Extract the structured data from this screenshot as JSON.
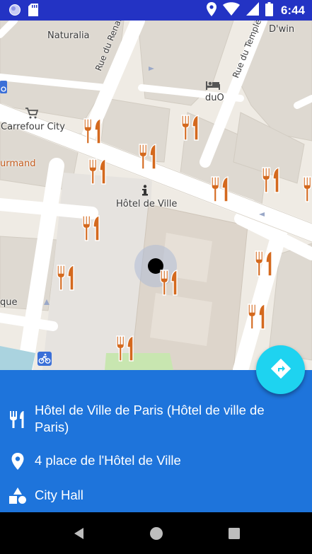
{
  "status_bar": {
    "time": "6:44",
    "left_icons": [
      "circle-notification-icon",
      "sd-card-icon"
    ],
    "right_icons": [
      "location-icon",
      "wifi-icon",
      "cellular-signal-icon",
      "battery-icon"
    ]
  },
  "map": {
    "labels": {
      "naturalia": "Naturalia",
      "dwin": "D'win",
      "rue_du_renard": "Rue du Renard",
      "rue_du_temple": "Rue du Temple",
      "duo": "duO",
      "carrefour_city": "Carrefour City",
      "urmand": "urmand",
      "hotel_de_ville": "Hôtel de Ville",
      "que": "que"
    },
    "poi_icons": [
      "restaurant-icon",
      "grocery-cart-icon",
      "hotel-icon",
      "info-icon",
      "bike-share-icon",
      "current-location-marker"
    ]
  },
  "fab": {
    "icon": "directions-icon",
    "color": "#1ed3f0"
  },
  "info_panel": {
    "background": "#1e74db",
    "name": "Hôtel de Ville de Paris (Hôtel de ville de Paris)",
    "address": "4 place de l'Hôtel de Ville",
    "category": "City Hall"
  },
  "nav_bar": {
    "buttons": [
      "back-icon",
      "home-icon",
      "recents-icon"
    ]
  },
  "colors": {
    "status_bar": "#2333c4",
    "map_land": "#efebe4",
    "map_road": "#ffffff",
    "map_building": "#ded9d1",
    "restaurant_icon": "#d4691e",
    "water": "#aad3df",
    "park": "#c8e6b0"
  }
}
